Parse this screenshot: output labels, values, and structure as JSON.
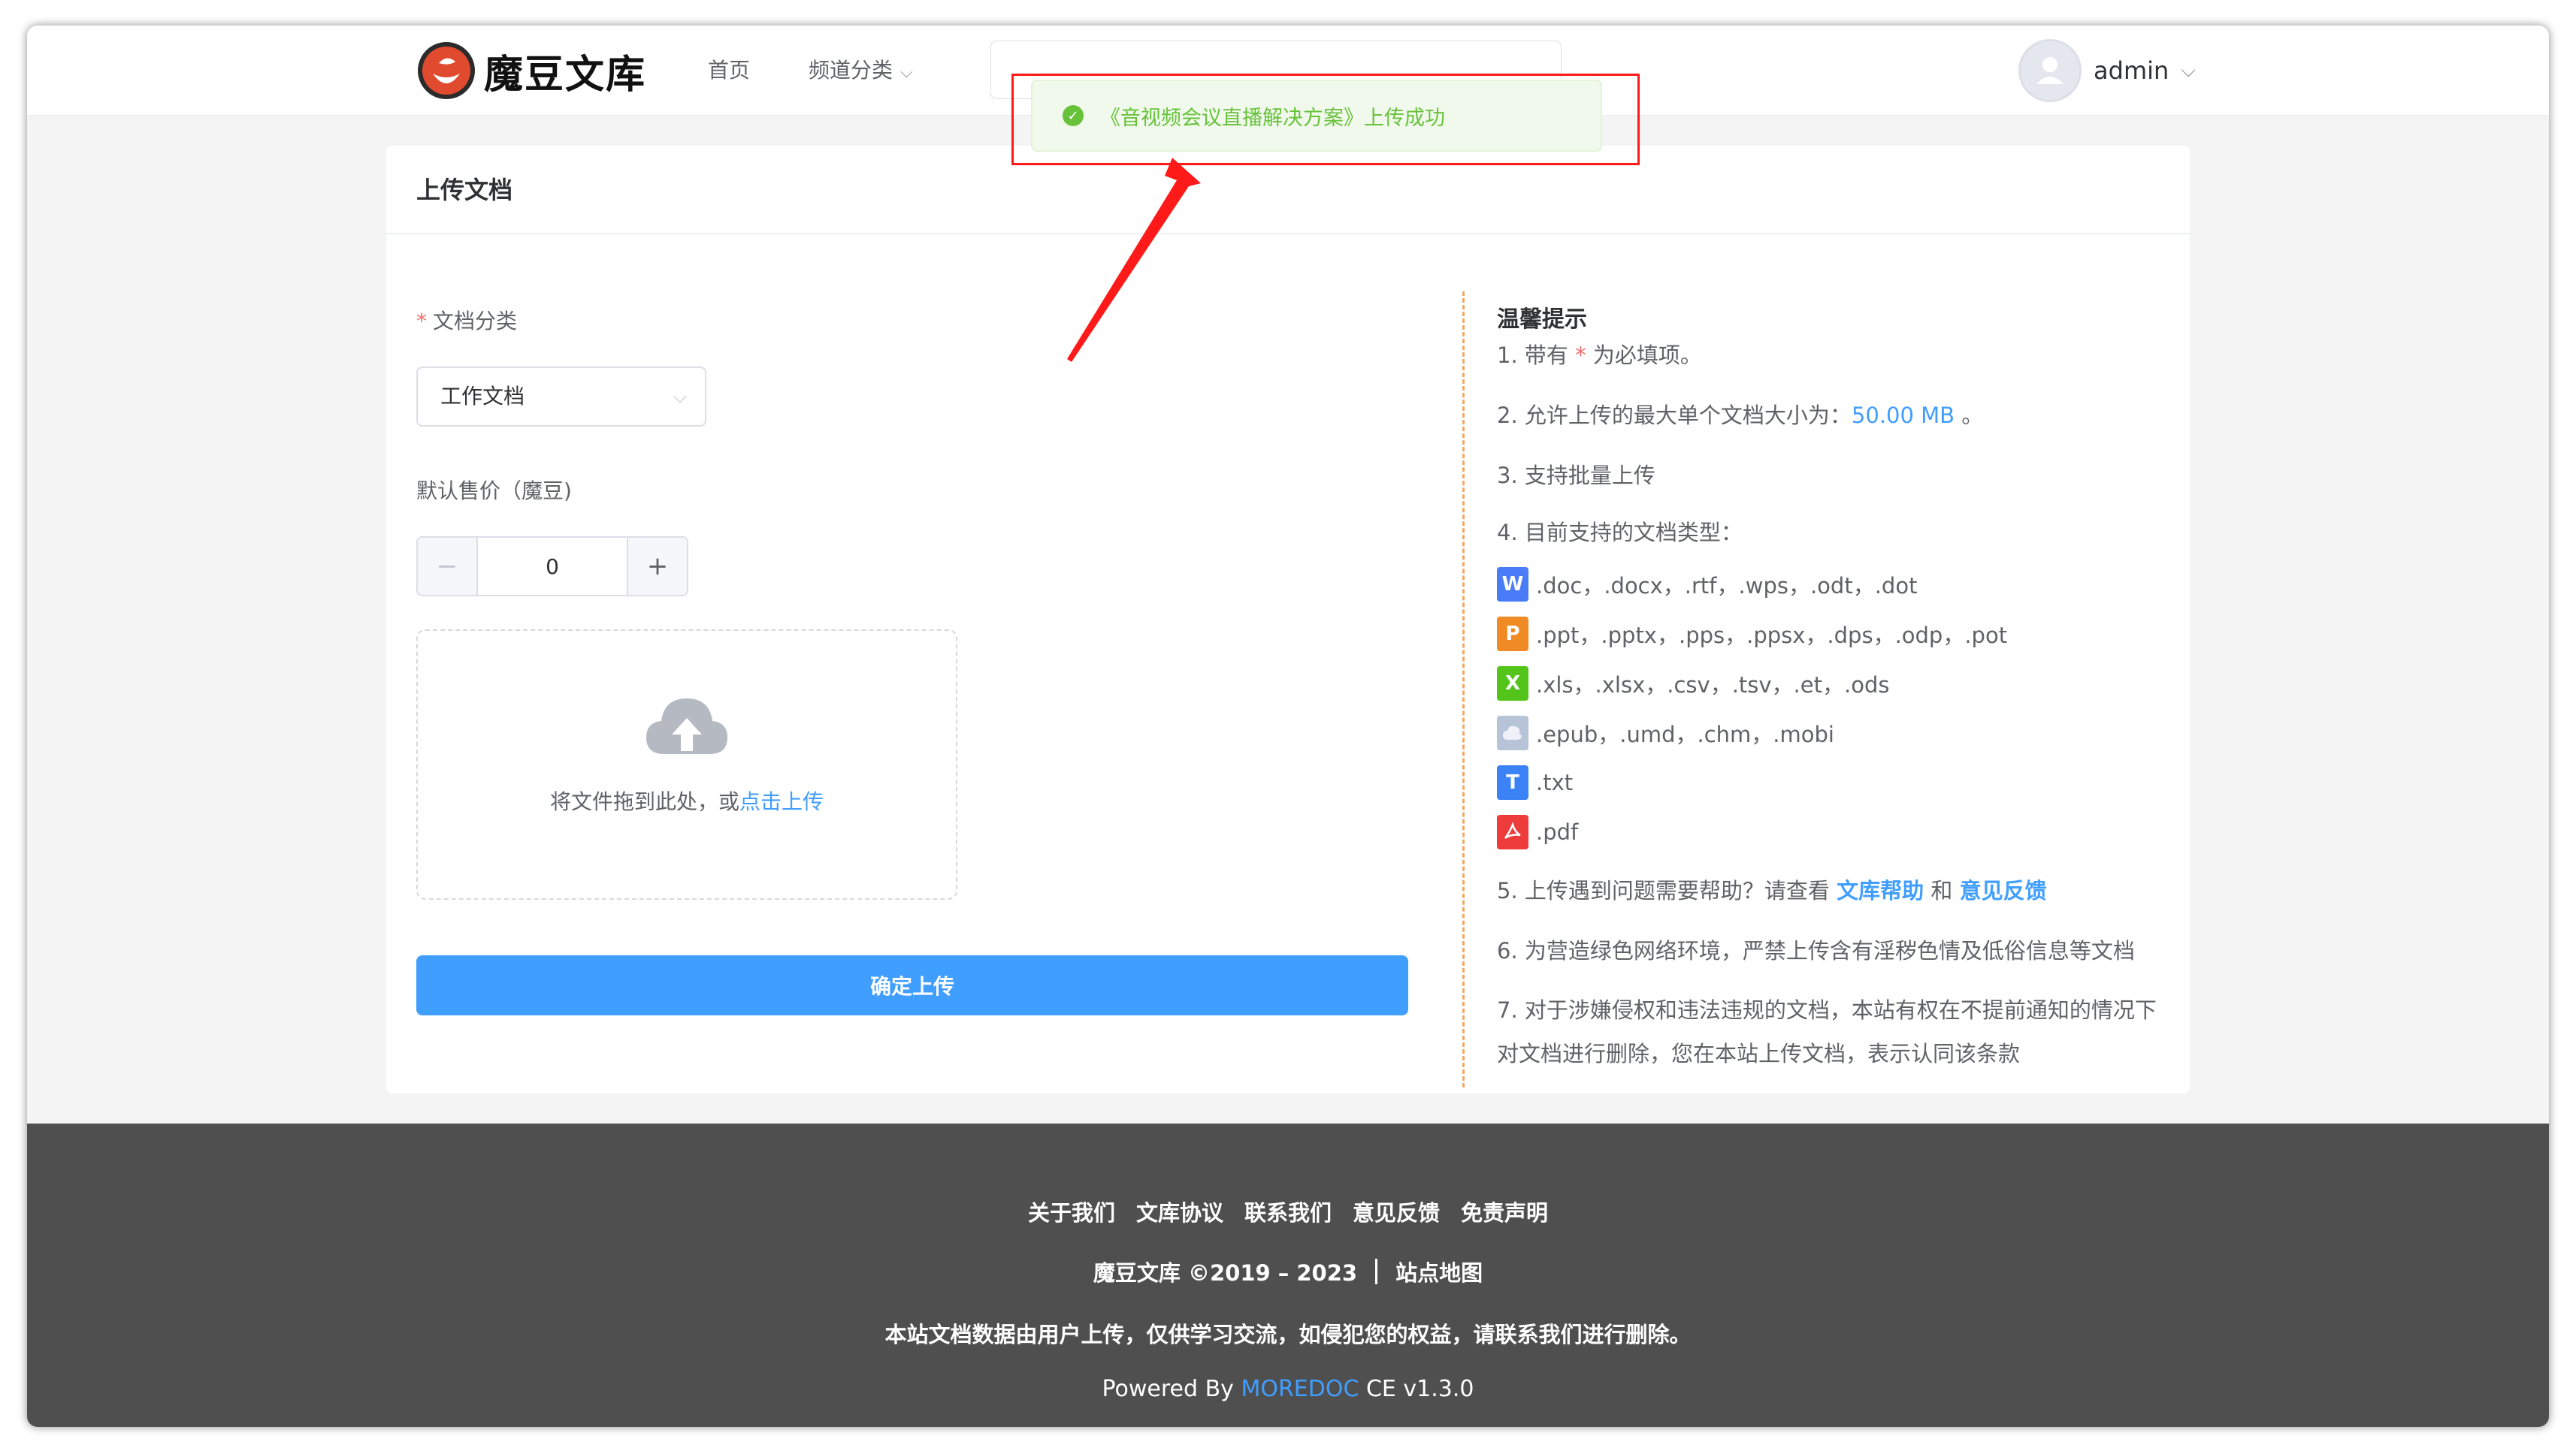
{
  "header": {
    "logo_text": "魔豆文库",
    "nav": [
      {
        "label": "首页"
      },
      {
        "label": "频道分类"
      }
    ],
    "user": {
      "name": "admin"
    }
  },
  "toast": {
    "message": "《音视频会议直播解决方案》上传成功",
    "color": "#67c23a"
  },
  "upload_form": {
    "title": "上传文档",
    "category_label": "文档分类",
    "category_value": "工作文档",
    "price_label": "默认售价（魔豆)",
    "price_value": "0",
    "dropzone_text": "将文件拖到此处，或",
    "dropzone_link": "点击上传",
    "submit_label": "确定上传"
  },
  "tips": {
    "title": "温馨提示",
    "t1_a": "1. 带有",
    "t1_star": "*",
    "t1_b": "为必填项。",
    "t2_a": "2. 允许上传的最大单个文档大小为：",
    "t2_size": "50.00 MB",
    "t2_b": "。",
    "t3": "3. 支持批量上传",
    "t4": "4. 目前支持的文档类型：",
    "file_types": [
      {
        "icon": "word-icon",
        "letter": "W",
        "color": "#4a7cf7",
        "exts": ".doc，.docx，.rtf，.wps，.odt，.dot"
      },
      {
        "icon": "ppt-icon",
        "letter": "P",
        "color": "#f08a24",
        "exts": ".ppt，.pptx，.pps，.ppsx，.dps，.odp，.pot"
      },
      {
        "icon": "excel-icon",
        "letter": "X",
        "color": "#52c41a",
        "exts": ".xls，.xlsx，.csv，.tsv，.et，.ods"
      },
      {
        "icon": "epub-icon",
        "letter": "",
        "color": "#b7c4d8",
        "exts": ".epub，.umd，.chm，.mobi"
      },
      {
        "icon": "txt-icon",
        "letter": "T",
        "color": "#3b82f6",
        "exts": ".txt"
      },
      {
        "icon": "pdf-icon",
        "letter": "",
        "color": "#ee3b3b",
        "exts": ".pdf"
      }
    ],
    "t5_a": "5. 上传遇到问题需要帮助？请查看",
    "t5_link1": "文库帮助",
    "t5_and": "和",
    "t5_link2": "意见反馈",
    "t6": "6. 为营造绿色网络环境，严禁上传含有淫秽色情及低俗信息等文档",
    "t7_line1": "7. 对于涉嫌侵权和违法违规的文档，本站有权在不提前通知的情况下",
    "t7_line2": "对文档进行删除，您在本站上传文档，表示认同该条款"
  },
  "footer": {
    "links": [
      "关于我们",
      "文库协议",
      "联系我们",
      "意见反馈",
      "免责声明"
    ],
    "copyright": "魔豆文库 ©2019 – 2023",
    "sitemap": "站点地图",
    "notice": "本站文档数据由用户上传，仅供学习交流，如侵犯您的权益，请联系我们进行删除。",
    "powered_prefix": "Powered By ",
    "powered_brand": "MOREDOC",
    "powered_suffix": " CE v1.3.0"
  },
  "colors": {
    "primary": "#409eff",
    "success": "#67c23a",
    "danger": "#f56c6c",
    "annotation": "#ff1a1a"
  }
}
